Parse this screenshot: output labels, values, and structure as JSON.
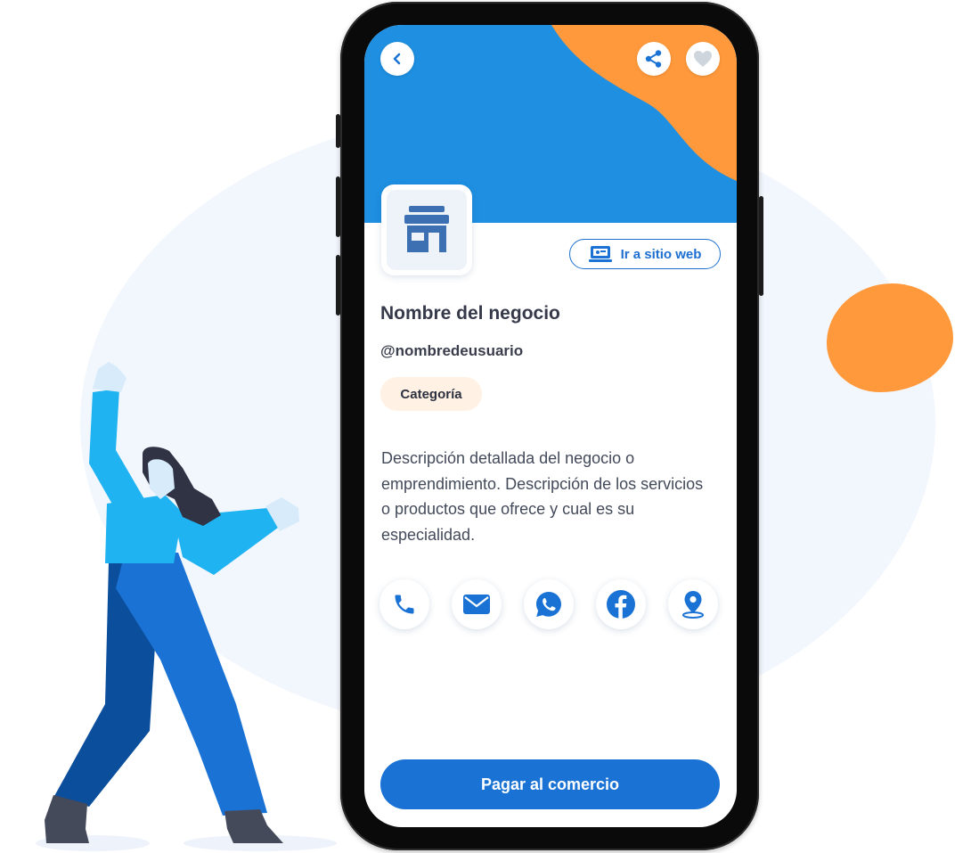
{
  "header": {
    "back_icon": "chevron-left-icon",
    "share_icon": "share-icon",
    "favorite_icon": "heart-icon"
  },
  "business": {
    "logo_icon": "storefront-icon",
    "website_button": "Ir a sitio web",
    "name": "Nombre del negocio",
    "username": "@nombredeusuario",
    "category": "Categoría",
    "description": "Descripción detallada del negocio o emprendimiento. Descripción de los servicios o productos que ofrece y cual es su especialidad."
  },
  "contacts": [
    {
      "name": "phone",
      "icon": "phone-icon"
    },
    {
      "name": "email",
      "icon": "mail-icon"
    },
    {
      "name": "whatsapp",
      "icon": "whatsapp-icon"
    },
    {
      "name": "facebook",
      "icon": "facebook-icon"
    },
    {
      "name": "location",
      "icon": "location-pin-icon"
    }
  ],
  "pay_button": "Pagar al comercio",
  "colors": {
    "primary_blue": "#1a73d4",
    "hero_blue": "#1e8fe1",
    "accent_orange": "#ff993b",
    "category_bg": "#fff1e3"
  }
}
